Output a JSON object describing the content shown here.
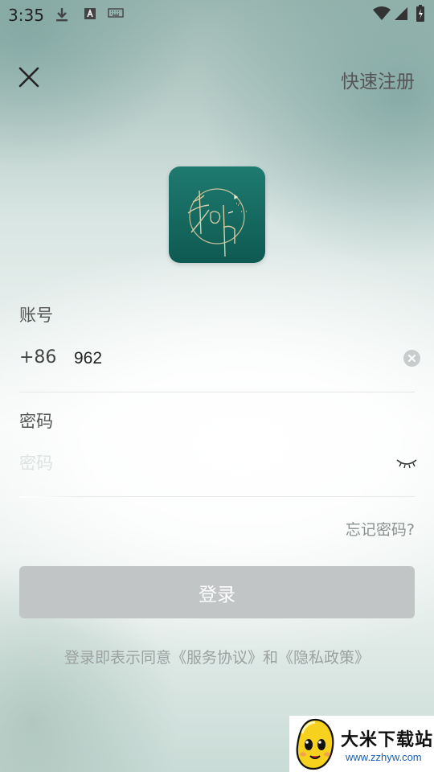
{
  "status_bar": {
    "time": "3:35",
    "icons": [
      "download-icon",
      "app-notification-icon",
      "keyboard-icon",
      "wifi-icon",
      "signal-icon",
      "battery-icon"
    ]
  },
  "nav": {
    "close_icon": "close-icon",
    "register_label": "快速注册"
  },
  "logo": {
    "icon": "app-logo-icon",
    "bg_color": "#0e5a52"
  },
  "account": {
    "label": "账号",
    "country_code": "+86",
    "value": "962",
    "clear_icon": "clear-icon"
  },
  "password": {
    "label": "密码",
    "placeholder": "密码",
    "toggle_icon": "eye-closed-icon"
  },
  "forgot_label": "忘记密码?",
  "login_label": "登录",
  "agreement": {
    "prefix": "登录即表示同意",
    "service_link": "《服务协议》",
    "and": "和",
    "privacy_link": "《隐私政策》"
  },
  "watermark": {
    "title": "大米下载站",
    "url": "www.zzhyw.com"
  },
  "colors": {
    "button_disabled": "#c2c5c6",
    "text_muted": "#9aa1a0"
  }
}
